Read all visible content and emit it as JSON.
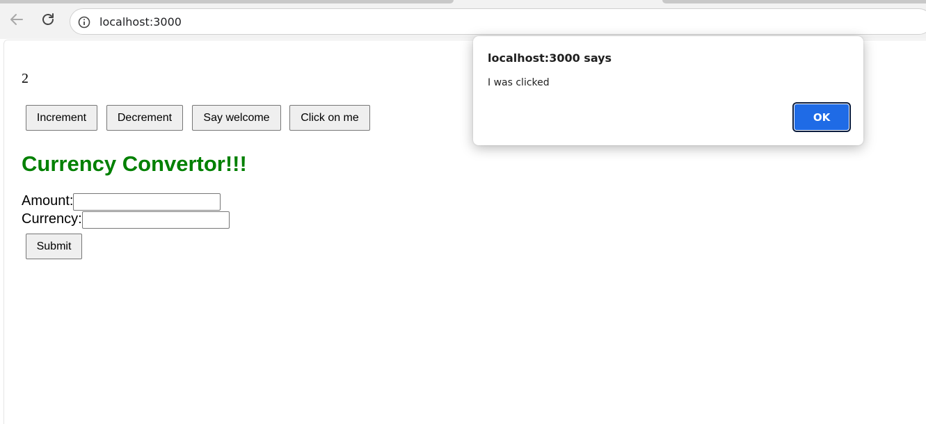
{
  "browser": {
    "url": "localhost:3000",
    "icons": {
      "back": "arrow-left-icon",
      "reload": "reload-icon",
      "site_info": "info-icon"
    }
  },
  "page": {
    "counter_value": "2",
    "buttons": {
      "increment": "Increment",
      "decrement": "Decrement",
      "say_welcome": "Say welcome",
      "click_on_me": "Click on me"
    },
    "heading": "Currency Convertor!!!",
    "heading_color": "#008000",
    "form": {
      "amount_label": "Amount:",
      "amount_value": "",
      "currency_label": "Currency:",
      "currency_value": "",
      "submit_label": "Submit"
    }
  },
  "alert": {
    "title": "localhost:3000 says",
    "message": "I was clicked",
    "ok_label": "OK",
    "ok_color": "#1f6be6"
  }
}
